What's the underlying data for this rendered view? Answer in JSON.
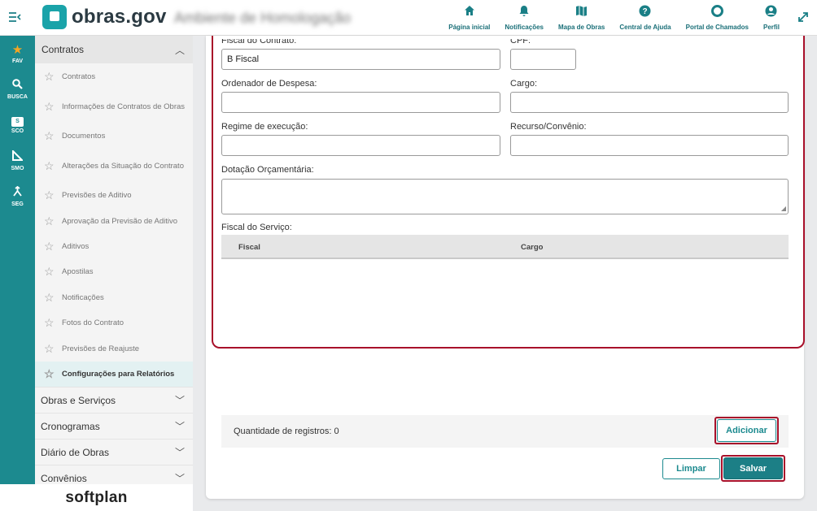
{
  "header": {
    "brand": "obras.gov",
    "environment": "Ambiente de Homologação",
    "nav": [
      {
        "label": "Página inicial",
        "icon": "home-icon"
      },
      {
        "label": "Notificações",
        "icon": "bell-icon"
      },
      {
        "label": "Mapa de Obras",
        "icon": "map-icon"
      },
      {
        "label": "Central de Ajuda",
        "icon": "help-icon"
      },
      {
        "label": "Portal de Chamados",
        "icon": "lifebuoy-icon"
      },
      {
        "label": "Perfil",
        "icon": "user-icon"
      }
    ]
  },
  "rail": [
    {
      "label": "FAV",
      "icon": "star-icon"
    },
    {
      "label": "BUSCA",
      "icon": "search-icon"
    },
    {
      "label": "SCO",
      "icon": "sco-icon",
      "badge": "S"
    },
    {
      "label": "SMO",
      "icon": "smo-icon"
    },
    {
      "label": "SEG",
      "icon": "seg-icon"
    }
  ],
  "sidebar": {
    "section": "Contratos",
    "items": [
      {
        "label": "Contratos"
      },
      {
        "label": "Informações de Contratos de Obras"
      },
      {
        "label": "Documentos"
      },
      {
        "label": "Alterações da Situação do Contrato"
      },
      {
        "label": "Previsões de Aditivo"
      },
      {
        "label": "Aprovação da Previsão de Aditivo"
      },
      {
        "label": "Aditivos"
      },
      {
        "label": "Apostilas"
      },
      {
        "label": "Notificações"
      },
      {
        "label": "Fotos do Contrato"
      },
      {
        "label": "Previsões de Reajuste"
      },
      {
        "label": "Configurações para Relatórios"
      }
    ],
    "other_sections": [
      "Obras e Serviços",
      "Cronogramas",
      "Diário de Obras",
      "Convênios"
    ],
    "footer_brand": "softplan"
  },
  "form": {
    "fiscal_contrato": {
      "label": "Fiscal do Contrato:",
      "value": "B Fiscal"
    },
    "cpf": {
      "label": "CPF:",
      "value": ""
    },
    "ordenador": {
      "label": "Ordenador de Despesa:",
      "value": ""
    },
    "cargo": {
      "label": "Cargo:",
      "value": ""
    },
    "regime": {
      "label": "Regime de execução:",
      "value": ""
    },
    "recurso": {
      "label": "Recurso/Convênio:",
      "value": ""
    },
    "dotacao": {
      "label": "Dotação Orçamentária:",
      "value": ""
    },
    "fiscal_servico": {
      "label": "Fiscal do Serviço:",
      "columns": [
        "Fiscal",
        "Cargo"
      ]
    }
  },
  "records": {
    "label": "Quantidade de registros: 0"
  },
  "buttons": {
    "add": "Adicionar",
    "clear": "Limpar",
    "save": "Salvar"
  }
}
